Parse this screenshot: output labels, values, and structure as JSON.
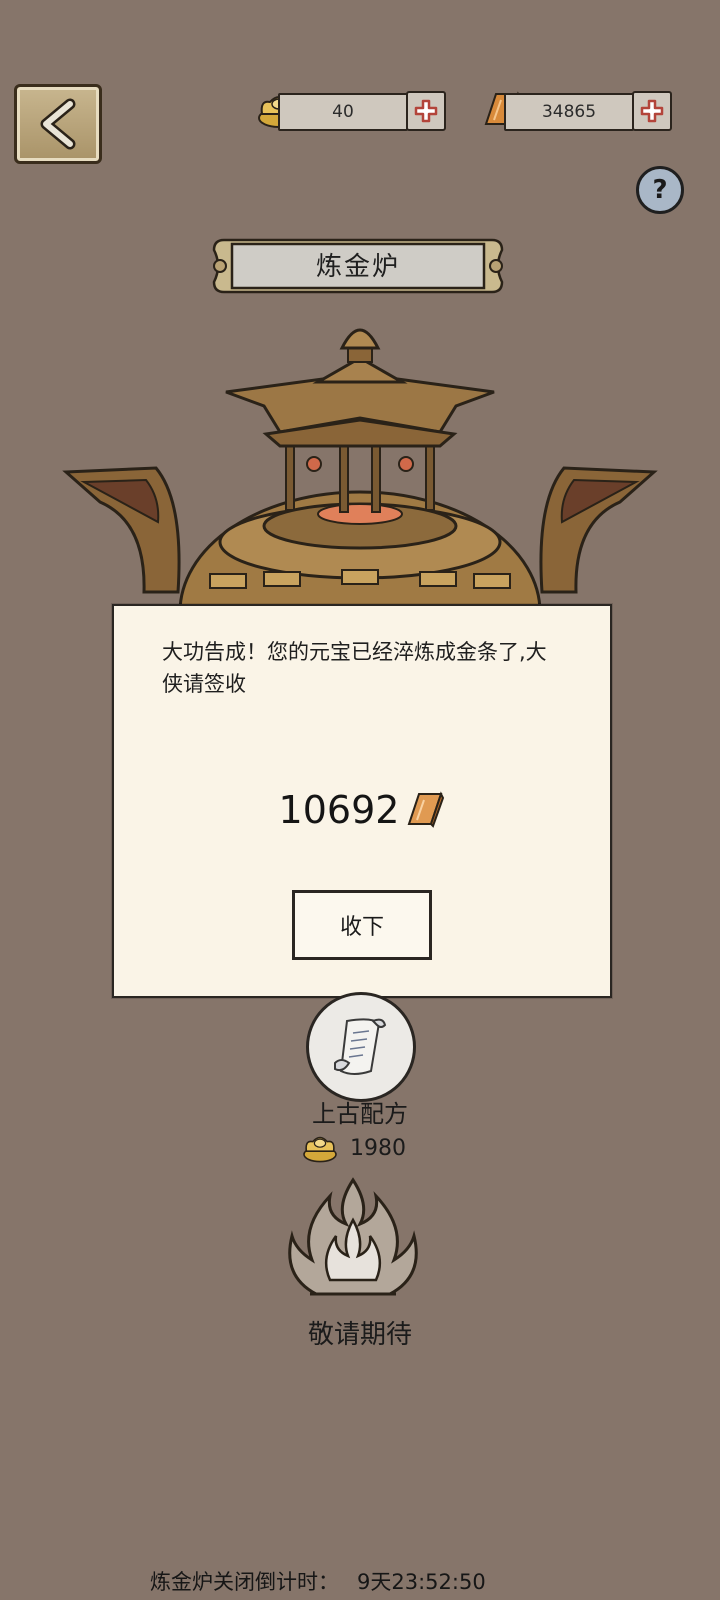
{
  "header": {
    "back_icon": "chevron-left-icon",
    "currency_a": {
      "icon": "yuanbao-ingot-icon",
      "value": "40"
    },
    "currency_b": {
      "icon": "gold-bar-icon",
      "value": "34865"
    },
    "help_icon": "question-mark-icon",
    "help_glyph": "?"
  },
  "title": "炼金炉",
  "dialog": {
    "message": "大功告成！您的元宝已经淬炼成金条了,大侠请签收",
    "reward_amount": "10692",
    "reward_icon": "gold-bar-icon",
    "accept_label": "收下"
  },
  "recipe": {
    "icon": "scroll-icon",
    "label": "上古配方",
    "cost_icon": "yuanbao-ingot-icon",
    "cost": "1980"
  },
  "coming_soon": {
    "icon": "flame-icon",
    "label": "敬请期待"
  },
  "footer": {
    "countdown_label": "炼金炉关闭倒计时：",
    "countdown_value": "9天23:52:50"
  },
  "colors": {
    "background": "#86756a",
    "dialog_bg": "#faf4e7",
    "gold": "#c9a24a",
    "bronze": "#8d6a3a"
  }
}
